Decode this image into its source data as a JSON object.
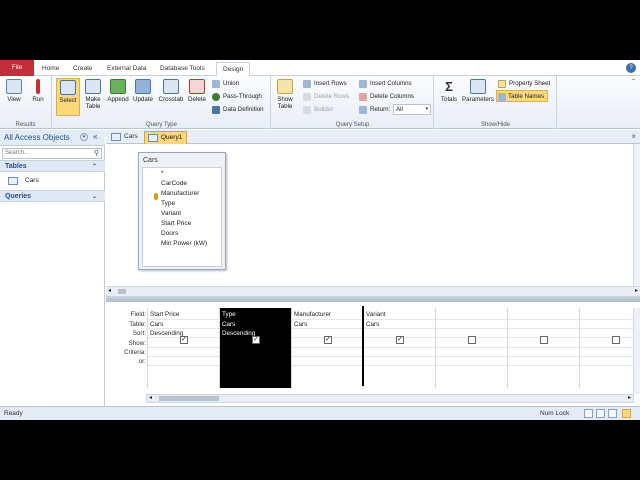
{
  "ribbon_tabs": [
    "File",
    "Home",
    "Create",
    "External Data",
    "Database Tools",
    "Design"
  ],
  "ribbon": {
    "results": {
      "label": "Results",
      "view": "View",
      "run": "Run"
    },
    "query_type": {
      "label": "Query Type",
      "select": "Select",
      "make_table": [
        "Make",
        "Table"
      ],
      "append": "Append",
      "update": "Update",
      "crosstab": "Crosstab",
      "delete": "Delete",
      "union": "Union",
      "pass_through": "Pass-Through",
      "data_definition": "Data Definition"
    },
    "query_setup": {
      "label": "Query Setup",
      "show_table": [
        "Show",
        "Table"
      ],
      "insert_rows": "Insert Rows",
      "delete_rows": "Delete Rows",
      "builder": "Builder",
      "insert_columns": "Insert Columns",
      "delete_columns": "Delete Columns",
      "return_label": "Return:",
      "return_value": "All"
    },
    "show_hide": {
      "label": "Show/Hide",
      "totals": "Totals",
      "parameters": "Parameters",
      "property_sheet": "Property Sheet",
      "table_names": "Table Names"
    }
  },
  "nav": {
    "title": "All Access Objects",
    "search_placeholder": "Search...",
    "tables_header": "Tables",
    "tables": [
      "Cars"
    ],
    "queries_header": "Queries"
  },
  "doc_tabs": [
    "Cars",
    "Query1"
  ],
  "field_list": {
    "title": "Cars",
    "fields": [
      "*",
      "CarCode",
      "Manufacturer",
      "Type",
      "Variant",
      "Start Price",
      "Doors",
      "Min Power (kW)"
    ]
  },
  "grid": {
    "row_labels": [
      "Field:",
      "Table:",
      "Sort:",
      "Show:",
      "Criteria:",
      "or:"
    ],
    "columns": [
      {
        "field": "Start Price",
        "table": "Cars",
        "sort": "Descending",
        "show": true
      },
      {
        "field": "Type",
        "table": "Cars",
        "sort": "Descending",
        "show": true
      },
      {
        "field": "Manufacturer",
        "table": "Cars",
        "sort": "",
        "show": true
      },
      {
        "field": "Variant",
        "table": "Cars",
        "sort": "",
        "show": true
      },
      {
        "field": "",
        "table": "",
        "sort": "",
        "show": false
      },
      {
        "field": "",
        "table": "",
        "sort": "",
        "show": false
      },
      {
        "field": "",
        "table": "",
        "sort": "",
        "show": false
      }
    ]
  },
  "status": {
    "left": "Ready",
    "numlock": "Num Lock"
  },
  "colors": {
    "file_tab": "#c42e3b",
    "selected": "#fbd97a",
    "selected_column": "#000000"
  }
}
